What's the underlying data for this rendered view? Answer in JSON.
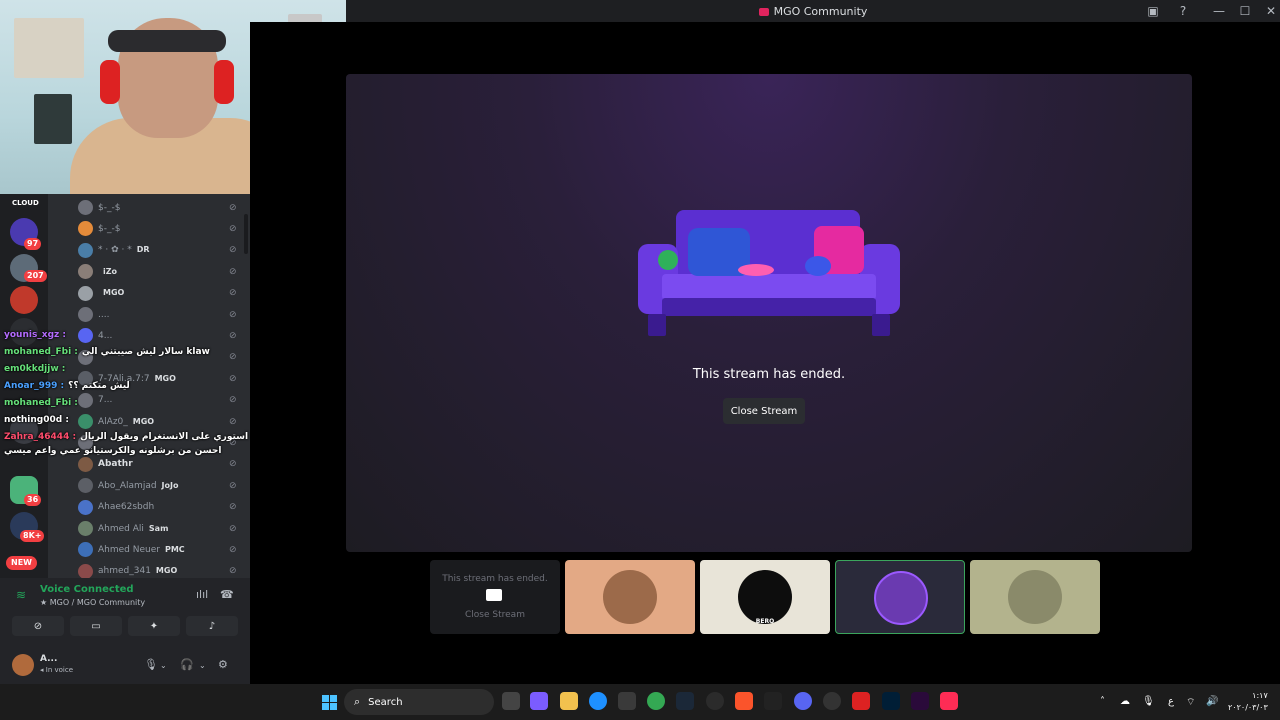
{
  "window": {
    "title": "MGO Community"
  },
  "members": [
    {
      "name": "$-_-$",
      "tag": "",
      "color": "#6d6f78"
    },
    {
      "name": "$-_-$",
      "tag": "",
      "color": "#e48b3a"
    },
    {
      "name": "* · ✿ · *",
      "tag": "DR",
      "color": "#4a7ea8"
    },
    {
      "name": "",
      "tag": "iZo",
      "color": "#8a7e78"
    },
    {
      "name": "",
      "tag": "MGO",
      "color": "#9aa0a6"
    },
    {
      "name": "....",
      "tag": "",
      "color": "#6d6f78"
    },
    {
      "name": "4...",
      "tag": "",
      "color": "#5865f2"
    },
    {
      "name": "",
      "tag": "",
      "color": "#6d6f78"
    },
    {
      "name": "7-7Ali.a.7:7",
      "tag": "MGO",
      "color": "#5a5e66"
    },
    {
      "name": "7...",
      "tag": "",
      "color": "#6d6f78"
    },
    {
      "name": "AlAz0_",
      "tag": "MGO",
      "color": "#3a8f6a"
    },
    {
      "name": "",
      "tag": "",
      "color": "#6d6f78"
    },
    {
      "name": "Abathr",
      "tag": "",
      "color": "#7d5a44",
      "highlight": true
    },
    {
      "name": "Abo_Alamjad",
      "tag": "JoJo",
      "color": "#5c5f66"
    },
    {
      "name": "Ahae62sbdh",
      "tag": "",
      "color": "#4a72c8"
    },
    {
      "name": "Ahmed Ali",
      "tag": "Sam",
      "color": "#6a7f6a"
    },
    {
      "name": "Ahmed Neuer",
      "tag": "PMC",
      "color": "#3d6fb8"
    },
    {
      "name": "ahmed_341",
      "tag": "MGO",
      "color": "#8a4a4a"
    }
  ],
  "chat": [
    {
      "user": "younis_xgz :",
      "msg": "",
      "color": "#b46cff"
    },
    {
      "user": "mohaned_Fbi :",
      "msg": "سالار ليش صيبتني الي  klaw",
      "color": "#66e07a"
    },
    {
      "user": "em0kkdjjw :",
      "msg": "",
      "color": "#66e07a"
    },
    {
      "user": "Anoar_999 :",
      "msg": "ليش متكتم ؟؟",
      "color": "#4aa0ff"
    },
    {
      "user": "mohaned_Fbi :",
      "msg": "",
      "color": "#66e07a"
    },
    {
      "user": "nothing00d :",
      "msg": "",
      "color": "#ffffff"
    },
    {
      "user": "Zahra_46444 :",
      "msg": "برشلوني بس خسر بل تحدي ويا الشباب وتحدوا يتزل استوري على الانستغرام ويقول الريال",
      "color": "#ff4d6d"
    },
    {
      "user": "",
      "msg": "احسن من برشلونه والكرستيانو عمي واعم ميسي",
      "color": "#ffffff"
    }
  ],
  "servers": {
    "top_label": "CLOUD",
    "badges": [
      "97",
      "207",
      "36",
      "8K+"
    ],
    "new_label": "NEW"
  },
  "voice": {
    "status": "Voice Connected",
    "location": "MGO / MGO Community"
  },
  "user_panel": {
    "name": "A...",
    "status": "In voice"
  },
  "stream": {
    "ended_text": "This stream has ended.",
    "close_label": "Close Stream"
  },
  "tiles": {
    "first_text": "This stream has ended.",
    "first_button": "Close Stream",
    "bero_label": "BERO"
  },
  "taskbar": {
    "search_label": "Search",
    "clock_time": "١:١٧",
    "clock_date": "٢٠٢٠/٠٣/٠٣",
    "lang": "ع"
  }
}
